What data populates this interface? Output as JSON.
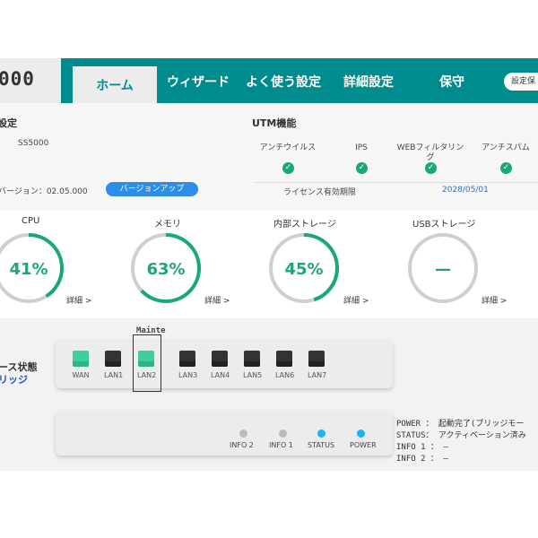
{
  "header": {
    "logo_text": "000",
    "tabs": [
      "ホーム",
      "ウィザード",
      "よく使う設定",
      "詳細設定",
      "保守"
    ],
    "settings_label": "設定保"
  },
  "device": {
    "title": "設定",
    "model": "SS5000",
    "version_text": "バージョン：02.05.000",
    "version_button": "バージョンアップ"
  },
  "utm": {
    "title": "UTM機能",
    "features": [
      "アンチウイルス",
      "IPS",
      "WEBフィルタリング",
      "アンチスパム"
    ],
    "license_label": "ライセンス有効期限",
    "license_date": "2028/05/01"
  },
  "gauges": [
    {
      "label": "CPU",
      "value_text": "41%",
      "percent": 41,
      "detail": "詳細 >"
    },
    {
      "label": "メモリ",
      "value_text": "63%",
      "percent": 63,
      "detail": "詳細 >"
    },
    {
      "label": "内部ストレージ",
      "value_text": "45%",
      "percent": 45,
      "detail": "詳細 >"
    },
    {
      "label": "USBストレージ",
      "value_text": "—",
      "percent": 0,
      "detail": "詳細 >"
    }
  ],
  "interface": {
    "title": "ース状態",
    "link": "リッジ",
    "mainte": "Mainte",
    "ports": [
      {
        "label": "WAN",
        "active": true
      },
      {
        "label": "LAN1",
        "active": false
      },
      {
        "label": "LAN2",
        "active": true
      },
      {
        "label": "LAN3",
        "active": false
      },
      {
        "label": "LAN4",
        "active": false
      },
      {
        "label": "LAN5",
        "active": false
      },
      {
        "label": "LAN6",
        "active": false
      },
      {
        "label": "LAN7",
        "active": false
      }
    ]
  },
  "leds": [
    {
      "label": "INFO 2",
      "on": false
    },
    {
      "label": "INFO 1",
      "on": false
    },
    {
      "label": "STATUS",
      "on": true
    },
    {
      "label": "POWER",
      "on": true
    }
  ],
  "status_lines": [
    "POWER ： 起動完了(ブリッジモー",
    "STATUS： アクティベーション済み",
    "INFO 1 ： —",
    "INFO 2 ： —"
  ],
  "colors": {
    "teal": "#008b8d",
    "green": "#1aa874",
    "blue": "#2c8ee8",
    "led_on": "#19b5f0",
    "led_off": "#bbbbbb"
  }
}
